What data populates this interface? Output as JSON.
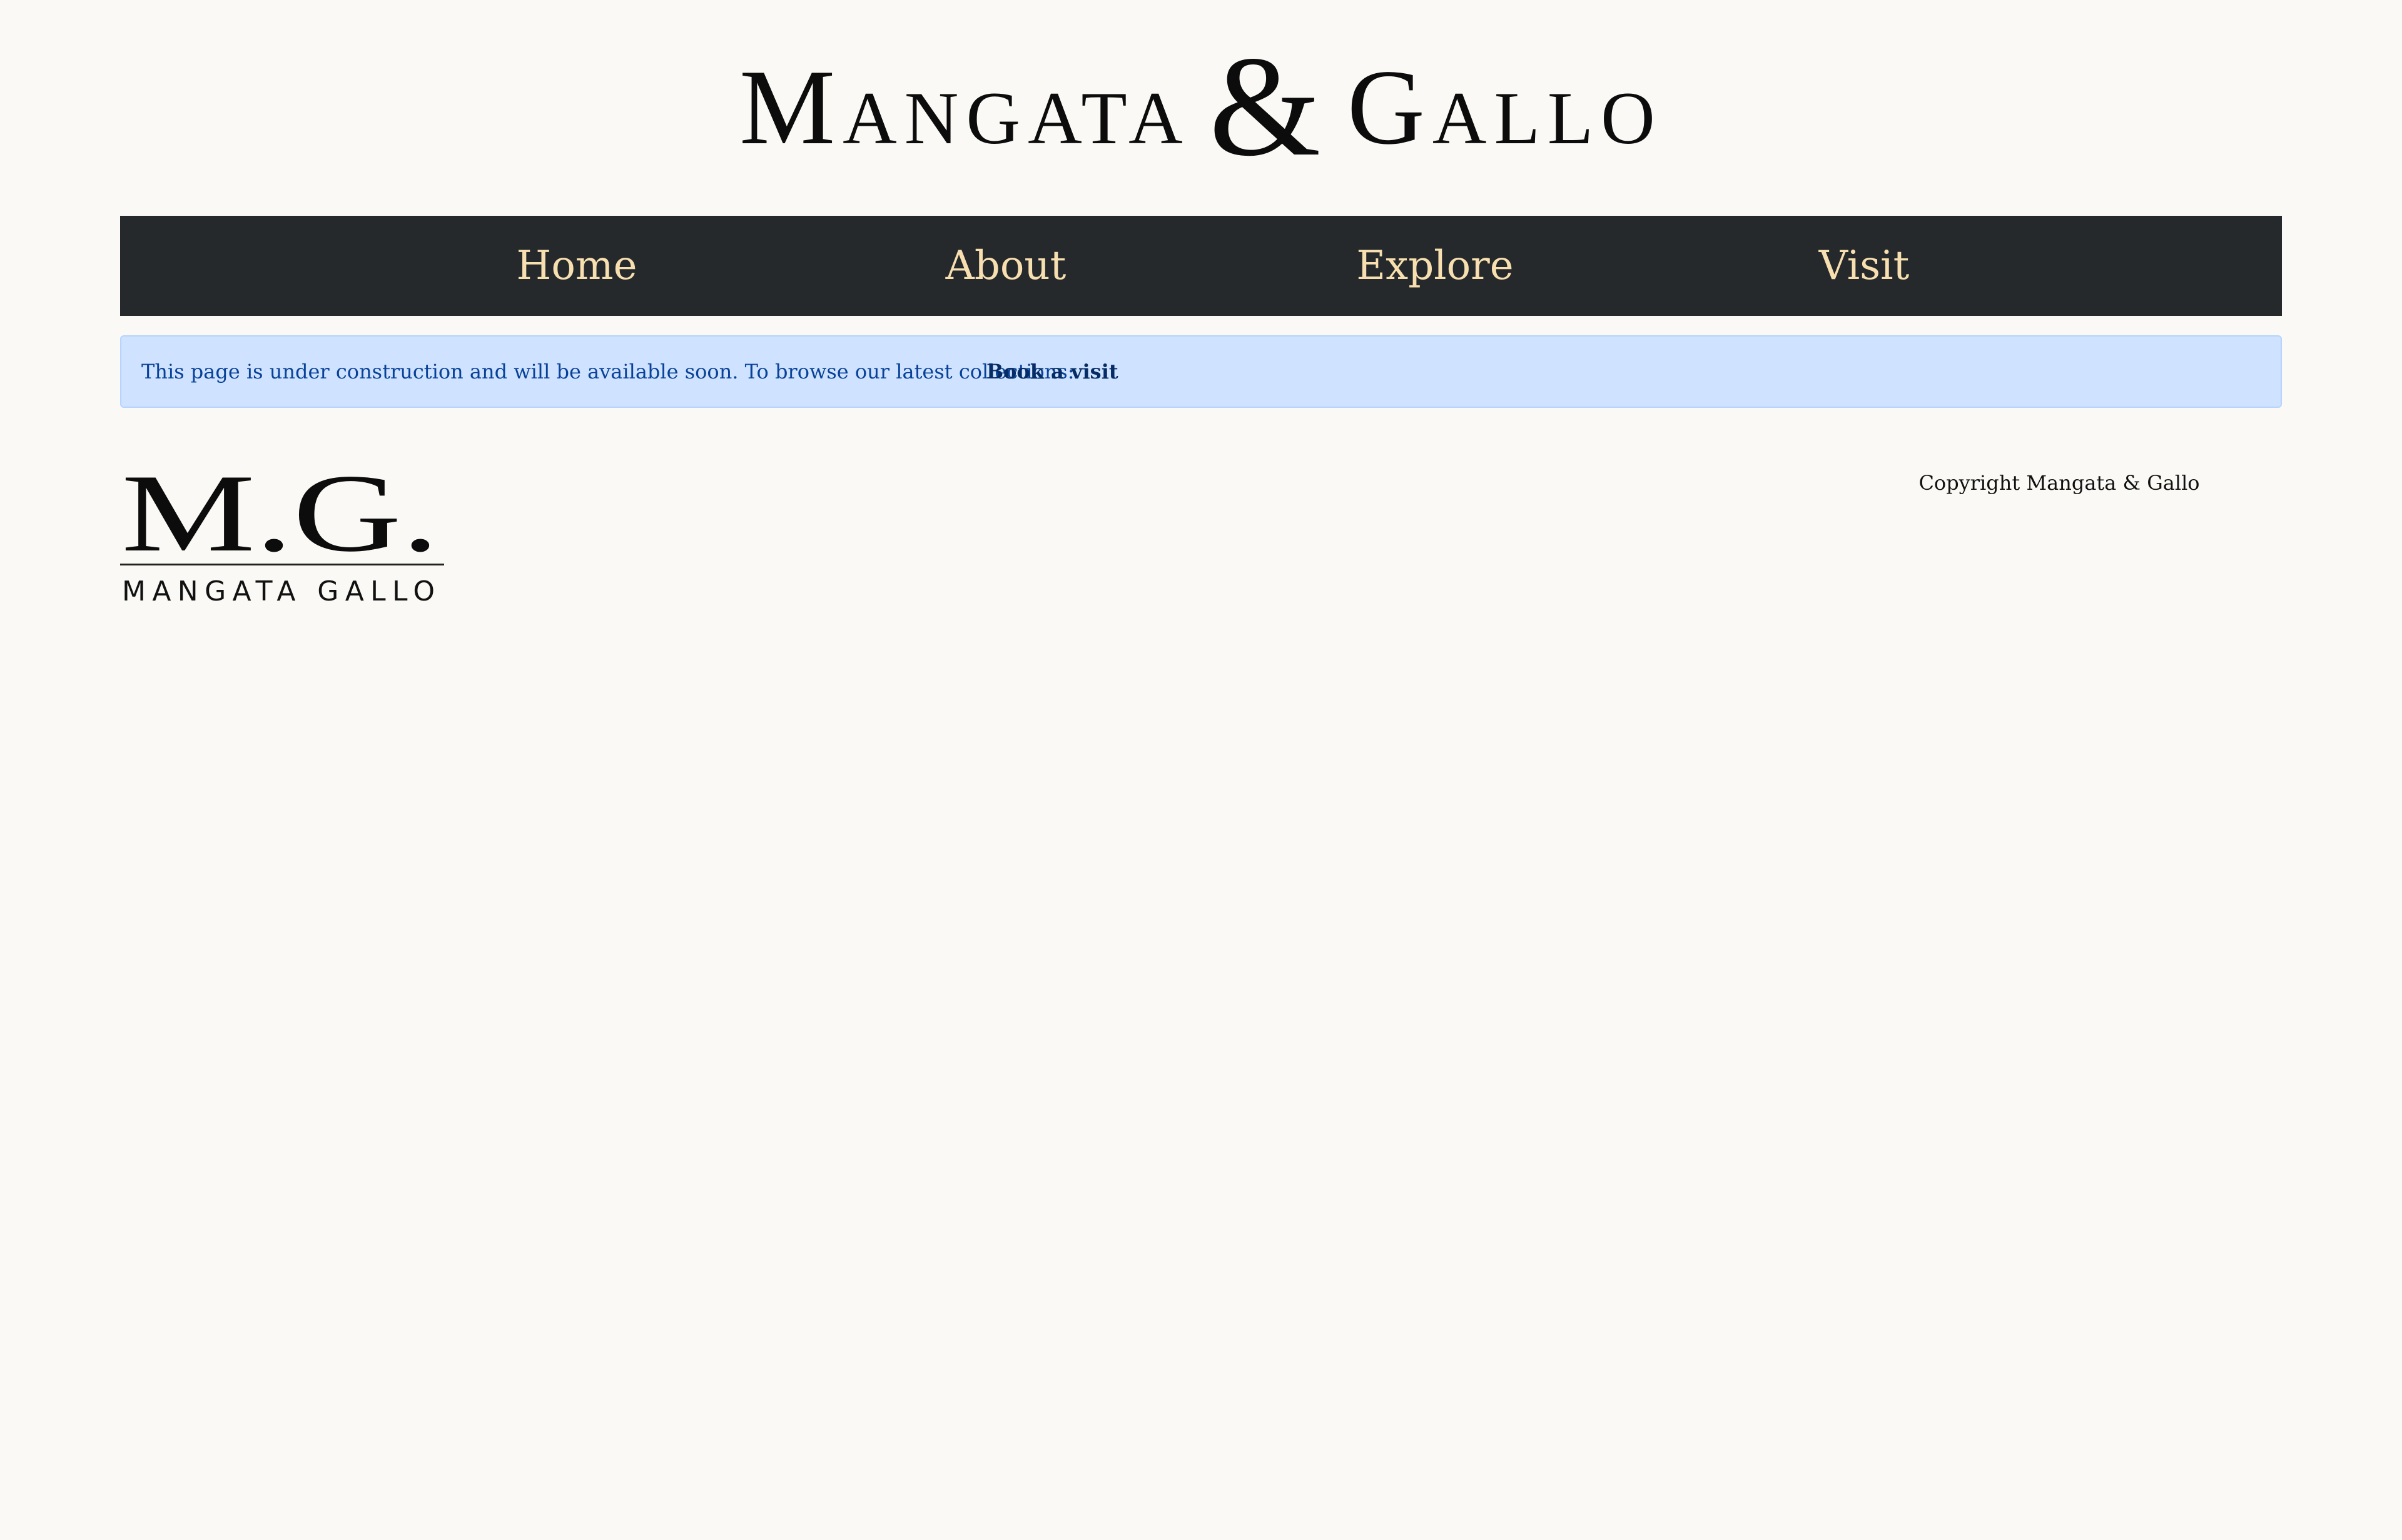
{
  "header": {
    "brand_left": "Mangata",
    "brand_amp": "&",
    "brand_right": "Gallo"
  },
  "nav": {
    "items": [
      {
        "label": "Home"
      },
      {
        "label": "About"
      },
      {
        "label": "Explore"
      },
      {
        "label": "Visit"
      }
    ]
  },
  "alert": {
    "message": "This page is under construction and will be available soon. To browse our latest collections:",
    "link_label": "Book a visit"
  },
  "footer": {
    "logo_monogram": "M.G.",
    "logo_wordmark": "MANGATA GALLO",
    "copyright": "Copyright Mangata & Gallo"
  },
  "colors": {
    "page_background": "#faf9f5",
    "navbar_background": "#25292c",
    "nav_text": "#f8dfb0",
    "alert_background": "#cfe2ff",
    "alert_text": "#084298"
  }
}
